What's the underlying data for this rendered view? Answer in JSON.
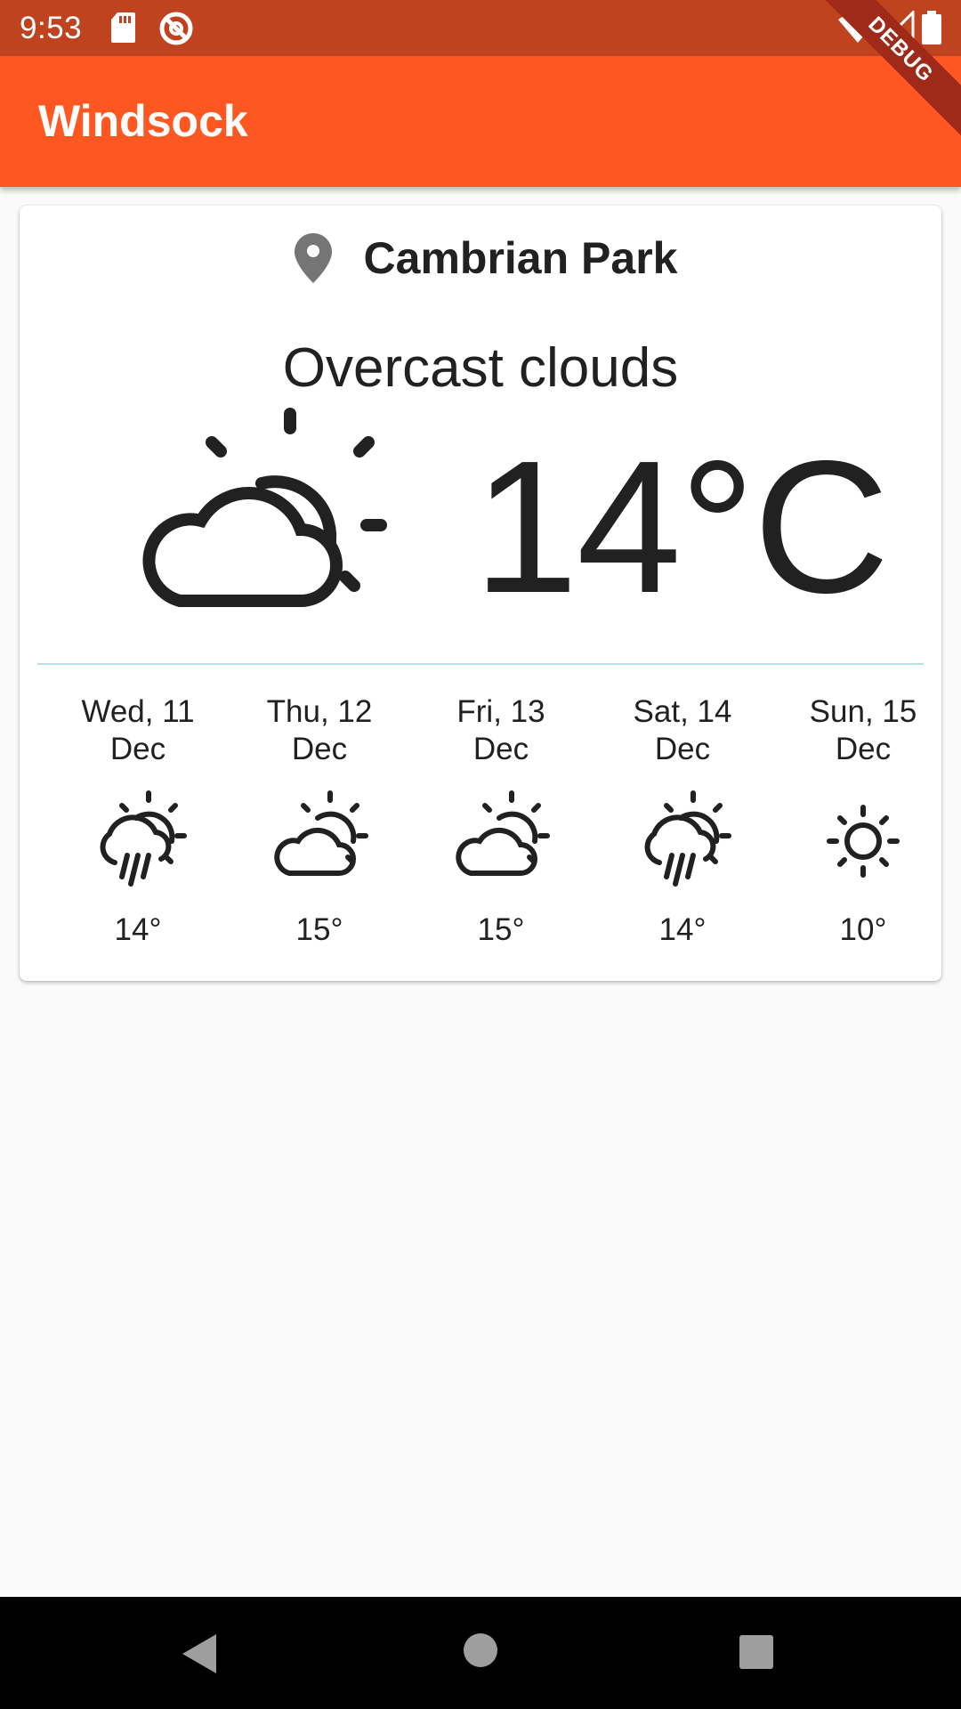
{
  "status_bar": {
    "time": "9:53",
    "icons": [
      "sd-card-icon",
      "sync-icon",
      "wifi-icon",
      "signal-icon",
      "battery-icon"
    ]
  },
  "debug_banner": "DEBUG",
  "app_bar": {
    "title": "Windsock",
    "color": "#FF5722",
    "status_color": "#BF431F"
  },
  "current": {
    "location_icon": "location-pin-icon",
    "location": "Cambrian Park",
    "condition": "Overcast clouds",
    "condition_icon": "partly-cloudy-icon",
    "temperature": "14°C"
  },
  "forecast": [
    {
      "day": "Wed, 11",
      "month": "Dec",
      "icon": "rain-partly-cloudy-icon",
      "temp": "14°"
    },
    {
      "day": "Thu, 12",
      "month": "Dec",
      "icon": "partly-cloudy-icon",
      "temp": "15°"
    },
    {
      "day": "Fri, 13",
      "month": "Dec",
      "icon": "partly-cloudy-icon",
      "temp": "15°"
    },
    {
      "day": "Sat, 14",
      "month": "Dec",
      "icon": "rain-partly-cloudy-icon",
      "temp": "14°"
    },
    {
      "day": "Sun, 15",
      "month": "Dec",
      "icon": "sun-icon",
      "temp": "10°"
    }
  ],
  "nav_bar": {
    "icons": [
      "back-icon",
      "home-icon",
      "recents-icon"
    ]
  }
}
